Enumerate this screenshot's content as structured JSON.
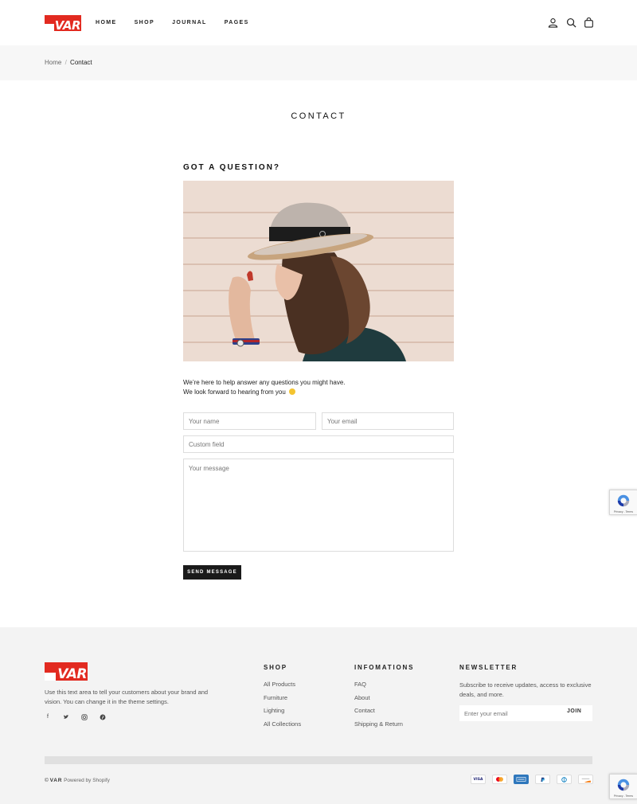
{
  "brand": {
    "name": "VAR",
    "color": "#e22a20"
  },
  "nav": {
    "items": [
      "HOME",
      "SHOP",
      "JOURNAL",
      "PAGES"
    ]
  },
  "header_icons": [
    "account-icon",
    "search-icon",
    "cart-icon"
  ],
  "breadcrumb": {
    "home": "Home",
    "separator": "/",
    "current": "Contact"
  },
  "page": {
    "title": "CONTACT"
  },
  "contact": {
    "heading": "GOT A QUESTION?",
    "intro_line1": "We’re here to help answer any questions you might have.",
    "intro_line2": "We look forward to hearing from you",
    "name_placeholder": "Your name",
    "email_placeholder": "Your email",
    "custom_placeholder": "Custom field",
    "message_placeholder": "Your message",
    "send_label": "SEND MESSAGE"
  },
  "recaptcha": {
    "text": "Privacy - Terms"
  },
  "footer": {
    "about": "Use this text area to tell your customers about your brand and vision. You can change it in the theme settings.",
    "socials": [
      "facebook-icon",
      "twitter-icon",
      "instagram-icon",
      "pinterest-icon"
    ],
    "shop": {
      "heading": "SHOP",
      "items": [
        "All Products",
        "Furniture",
        "Lighting",
        "All Collections"
      ]
    },
    "info": {
      "heading": "INFOMATIONS",
      "items": [
        "FAQ",
        "About",
        "Contact",
        "Shipping & Return"
      ]
    },
    "newsletter": {
      "heading": "NEWSLETTER",
      "text": "Subscribe to receive updates, access to exclusive deals, and more.",
      "placeholder": "Enter your email",
      "button": "JOIN"
    },
    "copyright_symbol": "©",
    "copyright_brand": "VAR",
    "powered": "Powered by Shopify",
    "payments": [
      "VISA",
      "Mastercard",
      "Amex",
      "PayPal",
      "Diners",
      "Discover"
    ]
  }
}
